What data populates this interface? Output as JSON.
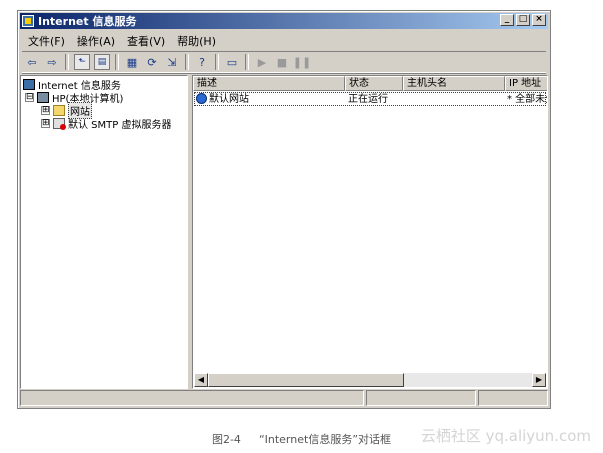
{
  "window": {
    "title": "Internet 信息服务",
    "buttons": {
      "minimize": "_",
      "maximize": "□",
      "close": "×"
    }
  },
  "menu": [
    "文件(F)",
    "操作(A)",
    "查看(V)",
    "帮助(H)"
  ],
  "toolbar": {
    "icons": [
      "back-arrow-icon",
      "forward-arrow-icon",
      "up-folder-icon",
      "show-tree-icon",
      "properties-icon",
      "refresh-icon",
      "export-icon",
      "help-icon",
      "computer-icon",
      "play-icon",
      "stop-icon",
      "pause-icon"
    ],
    "glyphs": {
      "back": "⇦",
      "forward": "⇨",
      "up": "⬑",
      "tree": "▤",
      "props": "▦",
      "refresh": "⟳",
      "export": "⇲",
      "help": "?",
      "computer": "▭",
      "play": "▶",
      "stop": "■",
      "pause": "❚❚"
    }
  },
  "tree": {
    "root": "Internet 信息服务",
    "server": "HP(本地计算机)",
    "sites": "网站",
    "smtp": "默认 SMTP 虚拟服务器",
    "expanders": {
      "server": "⊟",
      "sites": "⊞",
      "smtp": "⊞"
    }
  },
  "list": {
    "columns": [
      "描述",
      "状态",
      "主机头名",
      "IP 地址"
    ],
    "rows": [
      {
        "description": "默认网站",
        "status": "正在运行",
        "host": "",
        "ip": "* 全部未分"
      }
    ]
  },
  "scrollbar": {
    "left": "◀",
    "right": "▶"
  },
  "caption": {
    "figure": "图2-4",
    "text": "“Internet信息服务”对话框"
  },
  "watermark": "云栖社区 yq.aliyun.com",
  "colors": {
    "title_start": "#0a246a",
    "title_end": "#a6caf0",
    "chrome": "#d4d0c8"
  }
}
